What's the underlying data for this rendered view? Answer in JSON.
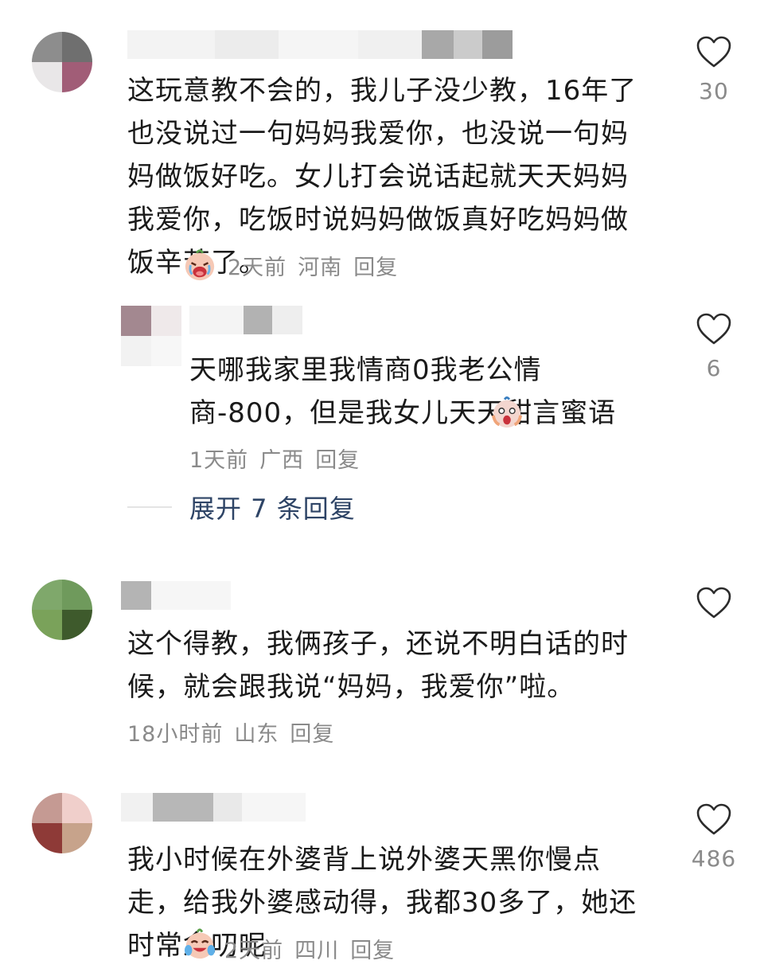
{
  "comments": [
    {
      "text": "这玩意教不会的，我儿子没少教，16年了也没说过一句妈妈我爱你，也没说一句妈妈做饭好吃。女儿打会说话起就天天妈妈我爱你，吃饭时说妈妈做饭真好吃妈妈做饭辛苦了。",
      "time": "2天前",
      "location": "河南",
      "reply_label": "回复",
      "likes": "30",
      "emoji": "crying-face",
      "replies": [
        {
          "text": "天哪我家里我情商0我老公情商-800，但是我女儿天天甜言蜜语",
          "time": "1天前",
          "location": "广西",
          "reply_label": "回复",
          "likes": "6",
          "emoji": "screaming-face"
        }
      ],
      "expand_label": "展开 7 条回复"
    },
    {
      "text": "这个得教，我俩孩子，还说不明白话的时候，就会跟我说“妈妈，我爱你”啦。",
      "time": "18小时前",
      "location": "山东",
      "reply_label": "回复",
      "likes": ""
    },
    {
      "text": "我小时候在外婆背上说外婆天黑你慢点走，给我外婆感动得，我都30多了，她还时常念叨呢",
      "time": "2天前",
      "location": "四川",
      "reply_label": "回复",
      "likes": "486",
      "emoji": "tears-of-joy-face"
    }
  ],
  "colors": {
    "meta": "#8a8a8a",
    "expand": "#2e4466",
    "heart": "#2b2b2b"
  }
}
